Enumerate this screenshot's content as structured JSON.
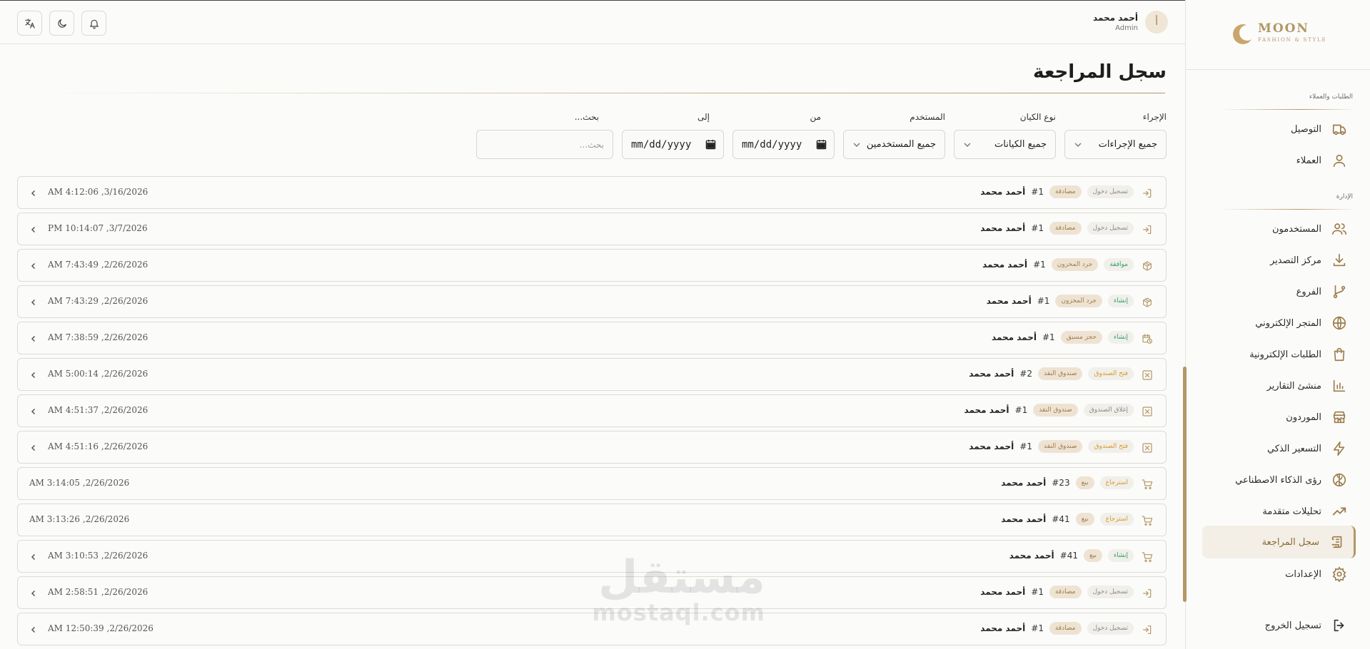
{
  "brand": {
    "title": "MOON",
    "subtitle": "FASHION & STYLE"
  },
  "header": {
    "user_name": "أحمد محمد",
    "user_role": "Admin",
    "avatar_letter": "أ"
  },
  "sidebar": {
    "section_orders": "الطلبات والعملاء",
    "section_admin": "الإدارة",
    "items": [
      {
        "label": "التوصيل",
        "icon": "truck-icon"
      },
      {
        "label": "العملاء",
        "icon": "user-icon"
      },
      {
        "label": "المستخدمون",
        "icon": "users-icon"
      },
      {
        "label": "مركز التصدير",
        "icon": "download-icon"
      },
      {
        "label": "الفروع",
        "icon": "git-branch-icon"
      },
      {
        "label": "المتجر الإلكتروني",
        "icon": "globe-icon"
      },
      {
        "label": "الطلبات الإلكترونية",
        "icon": "shopping-bag-icon"
      },
      {
        "label": "منشئ التقارير",
        "icon": "bar-chart-icon"
      },
      {
        "label": "الموردون",
        "icon": "store-icon"
      },
      {
        "label": "التسعير الذكي",
        "icon": "zap-icon"
      },
      {
        "label": "رؤى الذكاء الاصطناعي",
        "icon": "brain-icon"
      },
      {
        "label": "تحليلات متقدمة",
        "icon": "trending-up-icon"
      },
      {
        "label": "سجل المراجعة",
        "icon": "scroll-icon",
        "active": true
      },
      {
        "label": "الإعدادات",
        "icon": "settings-icon"
      }
    ],
    "logout": "تسجيل الخروج"
  },
  "page": {
    "title": "سجل المراجعة"
  },
  "filters": {
    "action_label": "الإجراء",
    "action_value": "جميع الإجراءات",
    "entity_label": "نوع الكيان",
    "entity_value": "جميع الكيانات",
    "user_label": "المستخدم",
    "user_value": "جميع المستخدمين",
    "from_label": "من",
    "from_value": "mm/dd/yyyy",
    "to_label": "إلى",
    "to_value": "mm/dd/yyyy",
    "search_label": "بحث...",
    "search_placeholder": "بحث..."
  },
  "logs": [
    {
      "icon": "log-in-icon",
      "action": "تسجيل دخول",
      "action_color": "gray",
      "entity": "مصادقة",
      "id": "#1",
      "user": "أحمد محمد",
      "time": "3/16/2026, 4:12:06 AM",
      "expandable": true
    },
    {
      "icon": "log-in-icon",
      "action": "تسجيل دخول",
      "action_color": "gray",
      "entity": "مصادقة",
      "id": "#1",
      "user": "أحمد محمد",
      "time": "3/7/2026, 10:14:07 PM",
      "expandable": true
    },
    {
      "icon": "package-icon",
      "action": "موافقة",
      "action_color": "green",
      "entity": "جرد المخزون",
      "id": "#1",
      "user": "أحمد محمد",
      "time": "2/26/2026, 7:43:49 AM",
      "expandable": true
    },
    {
      "icon": "package-icon",
      "action": "إنشاء",
      "action_color": "green",
      "entity": "جرد المخزون",
      "id": "#1",
      "user": "أحمد محمد",
      "time": "2/26/2026, 7:43:29 AM",
      "expandable": true
    },
    {
      "icon": "calendar-clock-icon",
      "action": "إنشاء",
      "action_color": "green",
      "entity": "حجز مسبق",
      "id": "#1",
      "user": "أحمد محمد",
      "time": "2/26/2026, 7:38:59 AM",
      "expandable": true
    },
    {
      "icon": "cash-box-icon",
      "action": "فتح الصندوق",
      "action_color": "amber",
      "entity": "صندوق النقد",
      "id": "#2",
      "user": "أحمد محمد",
      "time": "2/26/2026, 5:00:14 AM",
      "expandable": true
    },
    {
      "icon": "cash-box-icon",
      "action": "إغلاق الصندوق",
      "action_color": "gray",
      "entity": "صندوق النقد",
      "id": "#1",
      "user": "أحمد محمد",
      "time": "2/26/2026, 4:51:37 AM",
      "expandable": true
    },
    {
      "icon": "cash-box-icon",
      "action": "فتح الصندوق",
      "action_color": "amber",
      "entity": "صندوق النقد",
      "id": "#1",
      "user": "أحمد محمد",
      "time": "2/26/2026, 4:51:16 AM",
      "expandable": true
    },
    {
      "icon": "cart-icon",
      "action": "استرجاع",
      "action_color": "amber",
      "entity": "بيع",
      "id": "#23",
      "user": "أحمد محمد",
      "time": "2/26/2026, 3:14:05 AM",
      "expandable": false
    },
    {
      "icon": "cart-icon",
      "action": "استرجاع",
      "action_color": "amber",
      "entity": "بيع",
      "id": "#41",
      "user": "أحمد محمد",
      "time": "2/26/2026, 3:13:26 AM",
      "expandable": false
    },
    {
      "icon": "cart-icon",
      "action": "إنشاء",
      "action_color": "green",
      "entity": "بيع",
      "id": "#41",
      "user": "أحمد محمد",
      "time": "2/26/2026, 3:10:53 AM",
      "expandable": true
    },
    {
      "icon": "log-in-icon",
      "action": "تسجيل دخول",
      "action_color": "gray",
      "entity": "مصادقة",
      "id": "#1",
      "user": "أحمد محمد",
      "time": "2/26/2026, 2:58:51 AM",
      "expandable": true
    },
    {
      "icon": "log-in-icon",
      "action": "تسجيل دخول",
      "action_color": "gray",
      "entity": "مصادقة",
      "id": "#1",
      "user": "أحمد محمد",
      "time": "2/26/2026, 12:50:39 AM",
      "expandable": true
    }
  ],
  "watermark": {
    "arabic": "مستقل",
    "latin": "mostaql.com"
  }
}
